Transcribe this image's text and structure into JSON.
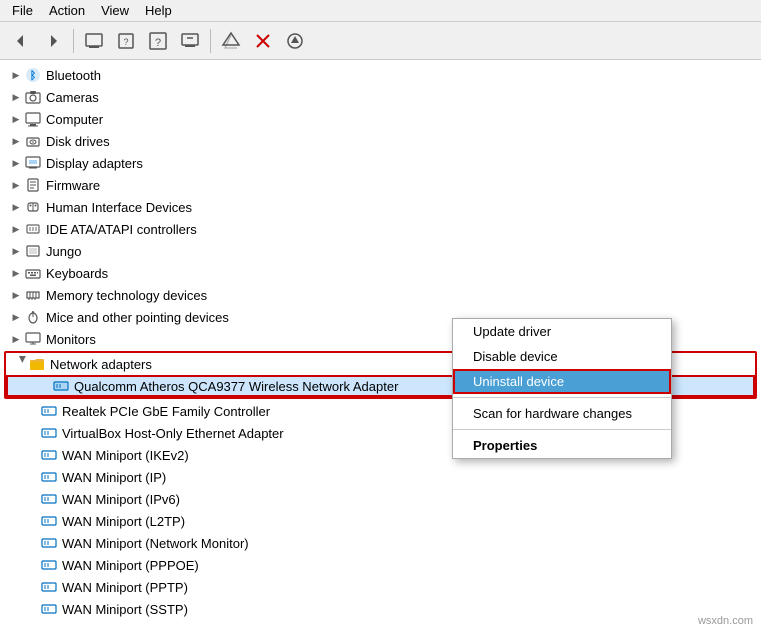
{
  "menubar": {
    "items": [
      "File",
      "Action",
      "View",
      "Help"
    ]
  },
  "toolbar": {
    "buttons": [
      {
        "name": "back",
        "icon": "◀",
        "disabled": false
      },
      {
        "name": "forward",
        "icon": "▶",
        "disabled": false
      },
      {
        "name": "properties",
        "icon": "🖥",
        "disabled": false
      },
      {
        "name": "update-driver",
        "icon": "📋",
        "disabled": false
      },
      {
        "name": "help",
        "icon": "❓",
        "disabled": false
      },
      {
        "name": "uninstall",
        "icon": "📺",
        "disabled": false
      },
      {
        "name": "scan-hardware",
        "icon": "📂",
        "disabled": false
      },
      {
        "name": "delete",
        "icon": "✖",
        "disabled": false
      },
      {
        "name": "add-legacy",
        "icon": "⬇",
        "disabled": false
      }
    ]
  },
  "tree": {
    "categories": [
      {
        "id": "bluetooth",
        "label": "Bluetooth",
        "icon": "bluetooth",
        "expanded": false,
        "level": 0
      },
      {
        "id": "cameras",
        "label": "Cameras",
        "icon": "camera",
        "expanded": false,
        "level": 0
      },
      {
        "id": "computer",
        "label": "Computer",
        "icon": "computer",
        "expanded": false,
        "level": 0
      },
      {
        "id": "disk-drives",
        "label": "Disk drives",
        "icon": "disk",
        "expanded": false,
        "level": 0
      },
      {
        "id": "display-adapters",
        "label": "Display adapters",
        "icon": "display",
        "expanded": false,
        "level": 0
      },
      {
        "id": "firmware",
        "label": "Firmware",
        "icon": "firmware",
        "expanded": false,
        "level": 0
      },
      {
        "id": "hid",
        "label": "Human Interface Devices",
        "icon": "hid",
        "expanded": false,
        "level": 0
      },
      {
        "id": "ide",
        "label": "IDE ATA/ATAPI controllers",
        "icon": "ide",
        "expanded": false,
        "level": 0
      },
      {
        "id": "jungo",
        "label": "Jungo",
        "icon": "jungo",
        "expanded": false,
        "level": 0
      },
      {
        "id": "keyboards",
        "label": "Keyboards",
        "icon": "keyboard",
        "expanded": false,
        "level": 0
      },
      {
        "id": "memory",
        "label": "Memory technology devices",
        "icon": "memory",
        "expanded": false,
        "level": 0
      },
      {
        "id": "mice",
        "label": "Mice and other pointing devices",
        "icon": "mouse",
        "expanded": false,
        "level": 0
      },
      {
        "id": "monitors",
        "label": "Monitors",
        "icon": "monitor",
        "expanded": false,
        "level": 0
      },
      {
        "id": "network-adapters",
        "label": "Network adapters",
        "icon": "network-folder",
        "expanded": true,
        "level": 0
      }
    ],
    "network_children": [
      {
        "id": "qualcomm",
        "label": "Qualcomm Atheros QCA9377 Wireless Network Adapter",
        "selected": true
      },
      {
        "id": "realtek",
        "label": "Realtek PCIe GbE Family Controller"
      },
      {
        "id": "virtualbox",
        "label": "VirtualBox Host-Only Ethernet Adapter"
      },
      {
        "id": "wan-ikev2",
        "label": "WAN Miniport (IKEv2)"
      },
      {
        "id": "wan-ip",
        "label": "WAN Miniport (IP)"
      },
      {
        "id": "wan-ipv6",
        "label": "WAN Miniport (IPv6)"
      },
      {
        "id": "wan-l2tp",
        "label": "WAN Miniport (L2TP)"
      },
      {
        "id": "wan-netmon",
        "label": "WAN Miniport (Network Monitor)"
      },
      {
        "id": "wan-pppoe",
        "label": "WAN Miniport (PPPOE)"
      },
      {
        "id": "wan-pptp",
        "label": "WAN Miniport (PPTP)"
      },
      {
        "id": "wan-sstp",
        "label": "WAN Miniport (SSTP)"
      }
    ]
  },
  "context_menu": {
    "items": [
      {
        "id": "update-driver",
        "label": "Update driver",
        "bold": false,
        "active": false
      },
      {
        "id": "disable-device",
        "label": "Disable device",
        "bold": false,
        "active": false
      },
      {
        "id": "uninstall-device",
        "label": "Uninstall device",
        "bold": false,
        "active": true
      },
      {
        "id": "sep",
        "type": "separator"
      },
      {
        "id": "scan-hardware",
        "label": "Scan for hardware changes",
        "bold": false,
        "active": false
      },
      {
        "id": "sep2",
        "type": "separator"
      },
      {
        "id": "properties",
        "label": "Properties",
        "bold": true,
        "active": false
      }
    ]
  },
  "watermark": "wsxdn.com"
}
